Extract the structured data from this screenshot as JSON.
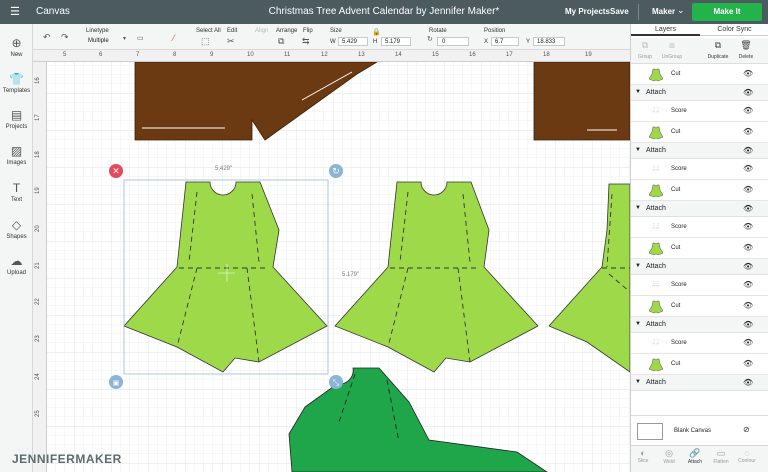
{
  "topbar": {
    "menu_icon": "hamburger-icon",
    "title": "Canvas",
    "document": "Christmas Tree Advent Calendar by Jennifer Maker*",
    "my_projects": "My Projects",
    "save": "Save",
    "machine": "Maker",
    "make_it": "Make It"
  },
  "toolbar": {
    "undo_icon": "undo-icon",
    "redo_icon": "redo-icon",
    "linetype_label": "Linetype",
    "linetype_value": "Multiple",
    "select_all": "Select All",
    "edit": "Edit",
    "align": "Align",
    "arrange": "Arrange",
    "flip": "Flip",
    "size_label": "Size",
    "w_label": "W",
    "w_value": "5.429",
    "h_label": "H",
    "h_value": "5.179",
    "rotate_label": "Rotate",
    "rotate_value": "0",
    "position_label": "Position",
    "x_label": "X",
    "x_value": "6.7",
    "y_label": "Y",
    "y_value": "18.833"
  },
  "leftbar": {
    "items": [
      {
        "label": "New",
        "icon": "plus-icon"
      },
      {
        "label": "Templates",
        "icon": "shirt-icon"
      },
      {
        "label": "Projects",
        "icon": "projects-icon"
      },
      {
        "label": "Images",
        "icon": "image-icon"
      },
      {
        "label": "Text",
        "icon": "text-icon"
      },
      {
        "label": "Shapes",
        "icon": "shapes-icon"
      },
      {
        "label": "Upload",
        "icon": "upload-icon"
      }
    ]
  },
  "ruler": {
    "top": [
      "5",
      "6",
      "7",
      "8",
      "9",
      "10",
      "11",
      "12",
      "13",
      "14",
      "15",
      "16",
      "17",
      "18",
      "19"
    ],
    "left": [
      "16",
      "17",
      "18",
      "19",
      "20",
      "21",
      "22",
      "23",
      "24",
      "25"
    ]
  },
  "selection": {
    "width_label": "5.429\"",
    "height_label": "5.179\""
  },
  "colors": {
    "brown": "#6b3a12",
    "light_green": "#9ed94a",
    "dark_green": "#1fa54a",
    "make_it": "#22b34a",
    "topbar": "#4b5b5f"
  },
  "panel": {
    "tab_layers": "Layers",
    "tab_color_sync": "Color Sync",
    "actions": [
      "Group",
      "UnGroup",
      "Duplicate",
      "Delete"
    ],
    "layers": [
      {
        "type": "row",
        "label": "Cut"
      },
      {
        "type": "group",
        "label": "Attach"
      },
      {
        "type": "row",
        "label": "Score"
      },
      {
        "type": "row",
        "label": "Cut"
      },
      {
        "type": "group",
        "label": "Attach"
      },
      {
        "type": "row",
        "label": "Score"
      },
      {
        "type": "row",
        "label": "Cut"
      },
      {
        "type": "group",
        "label": "Attach"
      },
      {
        "type": "row",
        "label": "Score"
      },
      {
        "type": "row",
        "label": "Cut"
      },
      {
        "type": "group",
        "label": "Attach"
      },
      {
        "type": "row",
        "label": "Score"
      },
      {
        "type": "row",
        "label": "Cut"
      },
      {
        "type": "group",
        "label": "Attach"
      },
      {
        "type": "row",
        "label": "Score"
      },
      {
        "type": "row",
        "label": "Cut"
      },
      {
        "type": "group",
        "label": "Attach"
      }
    ],
    "blank_canvas": "Blank Canvas",
    "bottom": [
      "Slice",
      "Weld",
      "Attach",
      "Flatten",
      "Contour"
    ]
  },
  "brand": "JENNIFERMAKER"
}
